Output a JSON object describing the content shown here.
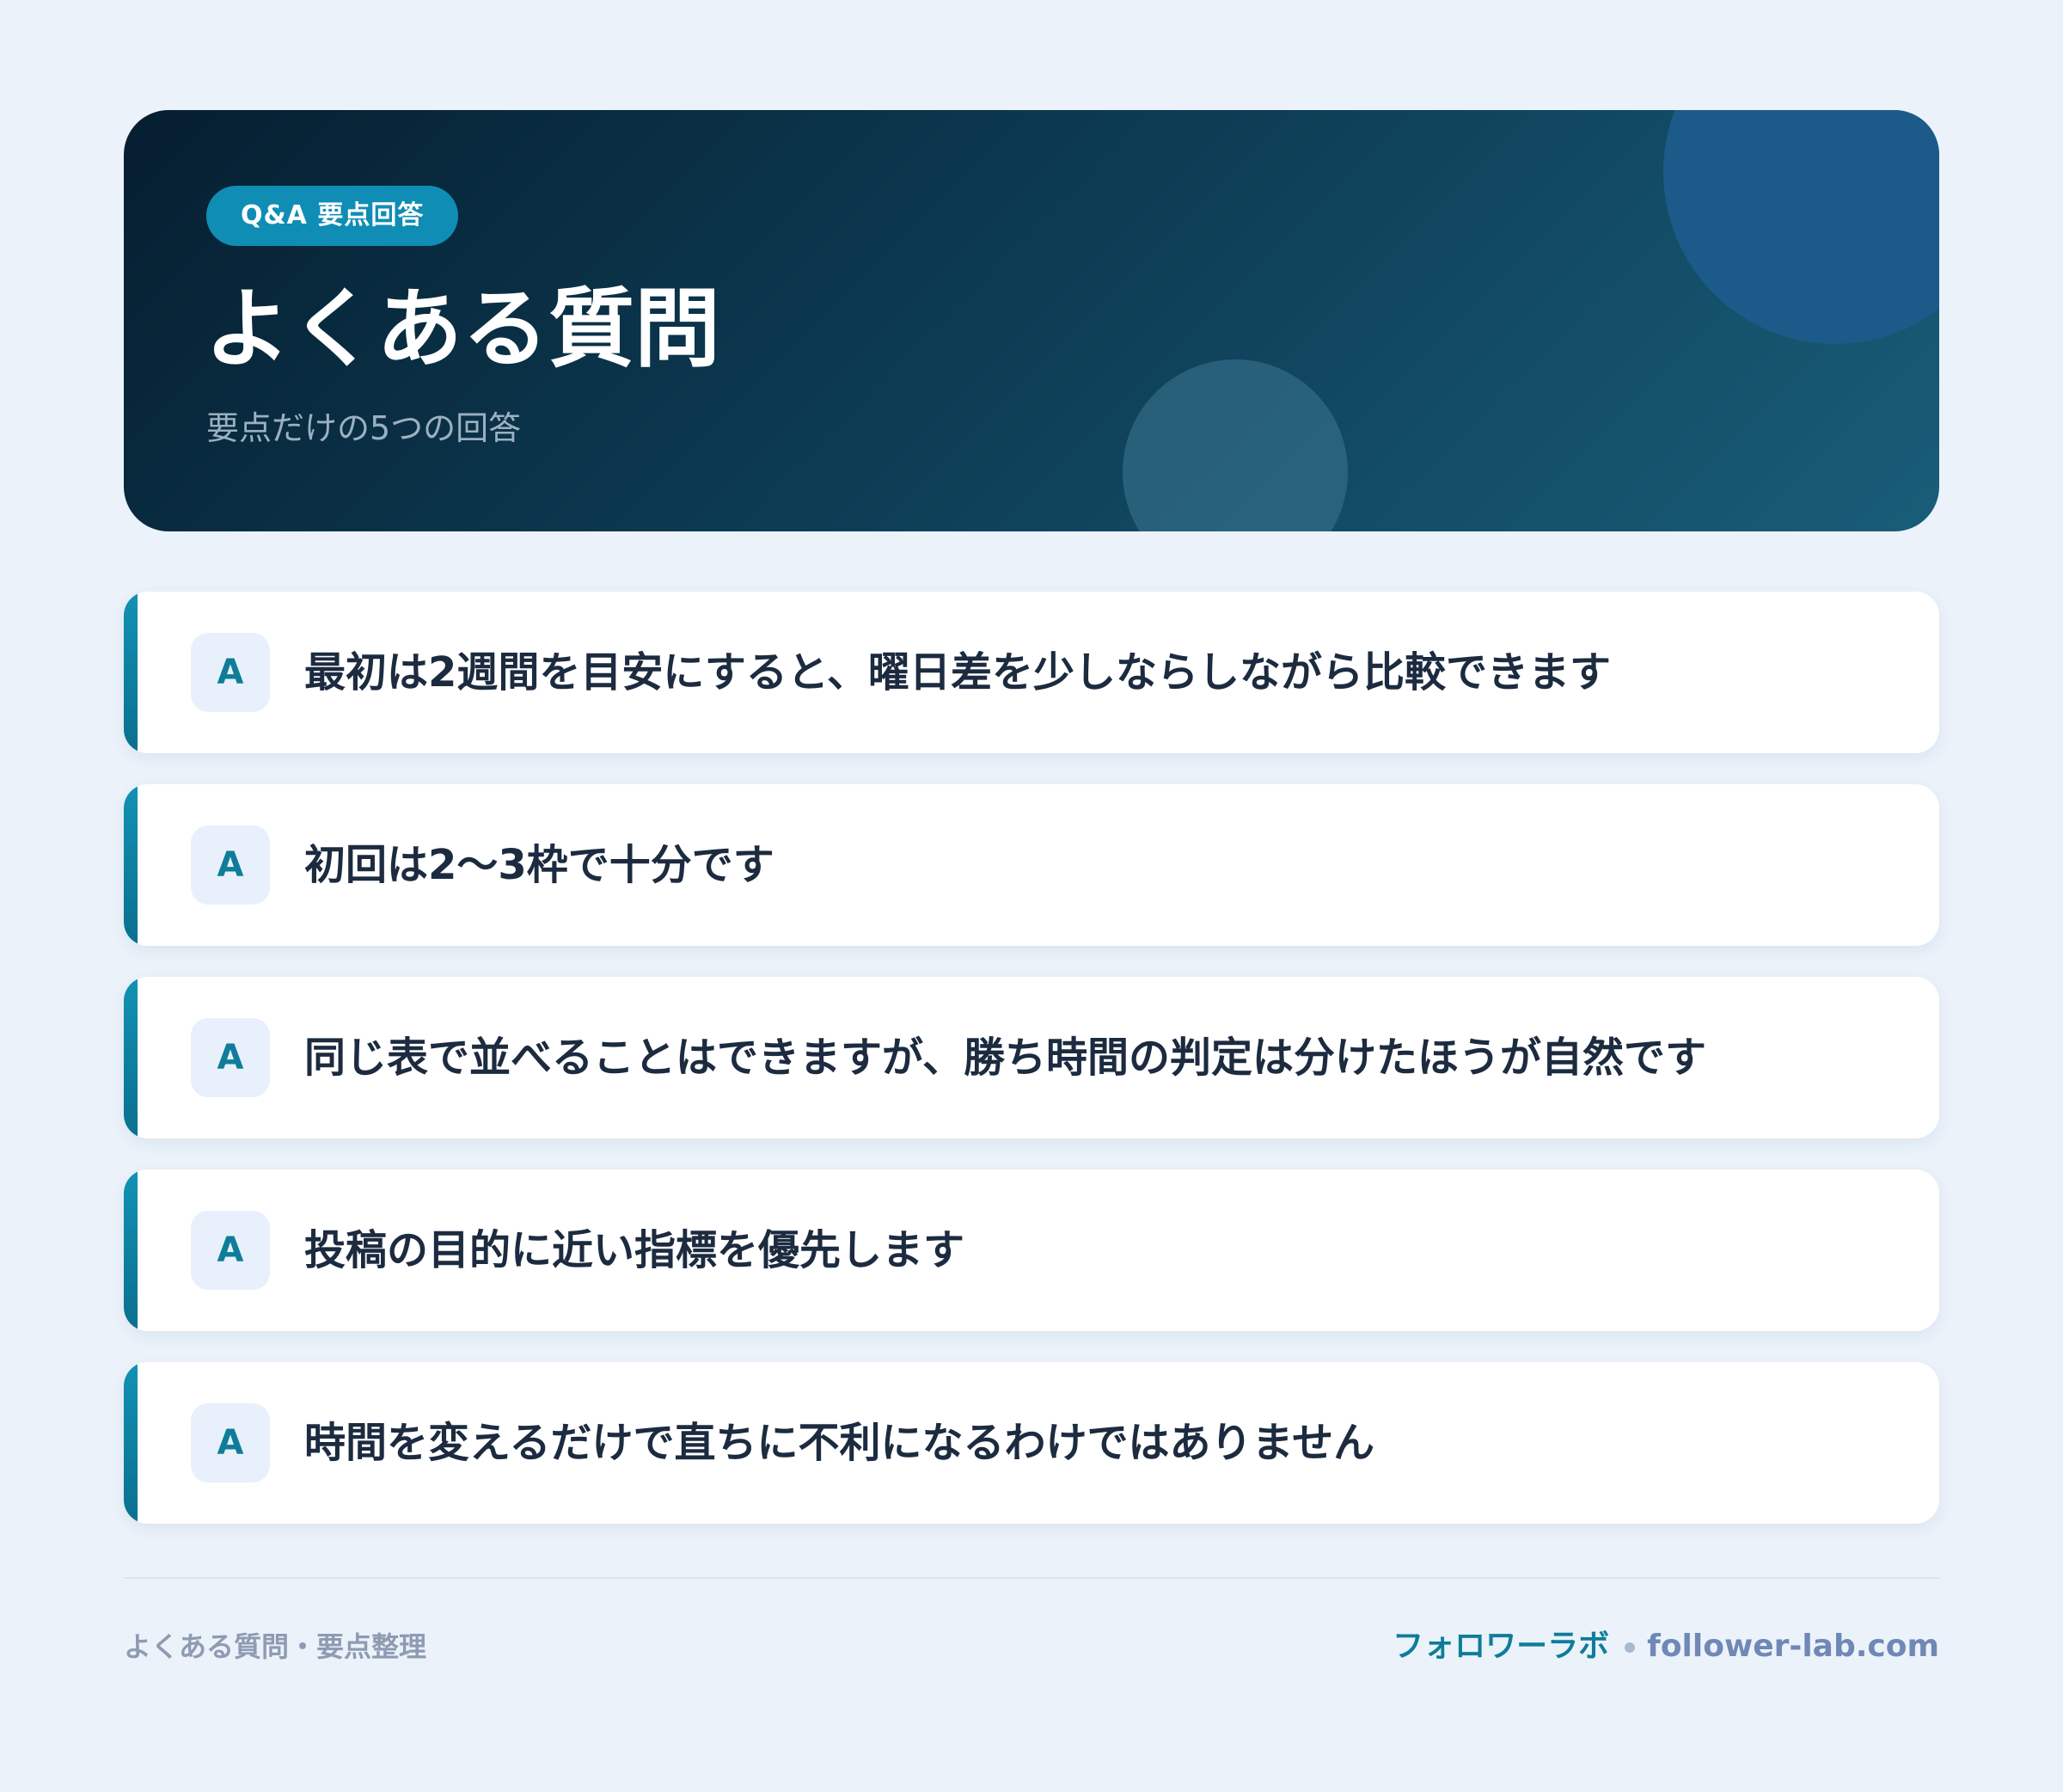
{
  "hero": {
    "badge": "Q&A 要点回答",
    "title": "よくある質問",
    "subtitle": "要点だけの5つの回答"
  },
  "answers": [
    {
      "marker": "A",
      "text": "最初は2週間を目安にすると、曜日差を少しならしながら比較できます"
    },
    {
      "marker": "A",
      "text": "初回は2〜3枠で十分です"
    },
    {
      "marker": "A",
      "text": "同じ表で並べることはできますが、勝ち時間の判定は分けたほうが自然です"
    },
    {
      "marker": "A",
      "text": "投稿の目的に近い指標を優先します"
    },
    {
      "marker": "A",
      "text": "時間を変えるだけで直ちに不利になるわけではありません"
    }
  ],
  "footer": {
    "left": "よくある質問・要点整理",
    "brand": "フォロワーラボ",
    "domain": "follower-lab.com"
  },
  "colors": {
    "background": "#ebf2fa",
    "hero_dark": "#061e30",
    "hero_light": "#195d78",
    "accent": "#0f8db4",
    "answer_text": "#1c2b3f"
  }
}
